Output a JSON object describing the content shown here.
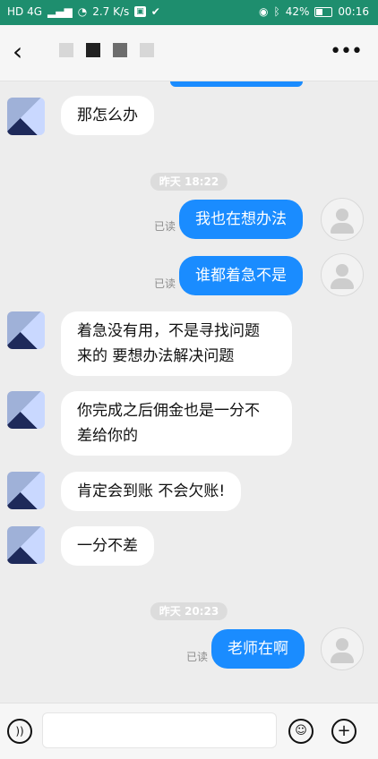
{
  "status_bar": {
    "network_left": "HD 4G",
    "speed": "2.7 K/s",
    "battery": "42%",
    "time": "00:16",
    "icons": [
      "signal-icon",
      "wifi-icon",
      "notification-icon",
      "check-shield-icon",
      "eye-icon",
      "bluetooth-icon",
      "battery-icon"
    ]
  },
  "header": {
    "back_icon": "back-arrow-icon",
    "more_icon": "more-icon"
  },
  "messages": [
    {
      "side": "left",
      "text": "那怎么办"
    },
    {
      "type": "time",
      "text": "昨天 18:22"
    },
    {
      "side": "right",
      "text": "我也在想办法",
      "read": "已读"
    },
    {
      "side": "right",
      "text": "谁都着急不是",
      "read": "已读"
    },
    {
      "side": "left",
      "lines": [
        "着急没有用，不是寻找问题",
        "来的 要想办法解决问题"
      ]
    },
    {
      "side": "left",
      "lines": [
        "你完成之后佣金也是一分不",
        "差给你的"
      ]
    },
    {
      "side": "left",
      "text": "肯定会到账 不会欠账!"
    },
    {
      "side": "left",
      "text": "一分不差"
    },
    {
      "type": "time",
      "text": "昨天 20:23"
    },
    {
      "side": "right",
      "text": "老师在啊",
      "read": "已读"
    }
  ],
  "input_bar": {
    "voice_icon": "voice-icon",
    "emoji_icon": "emoji-icon",
    "plus_icon": "plus-icon"
  }
}
